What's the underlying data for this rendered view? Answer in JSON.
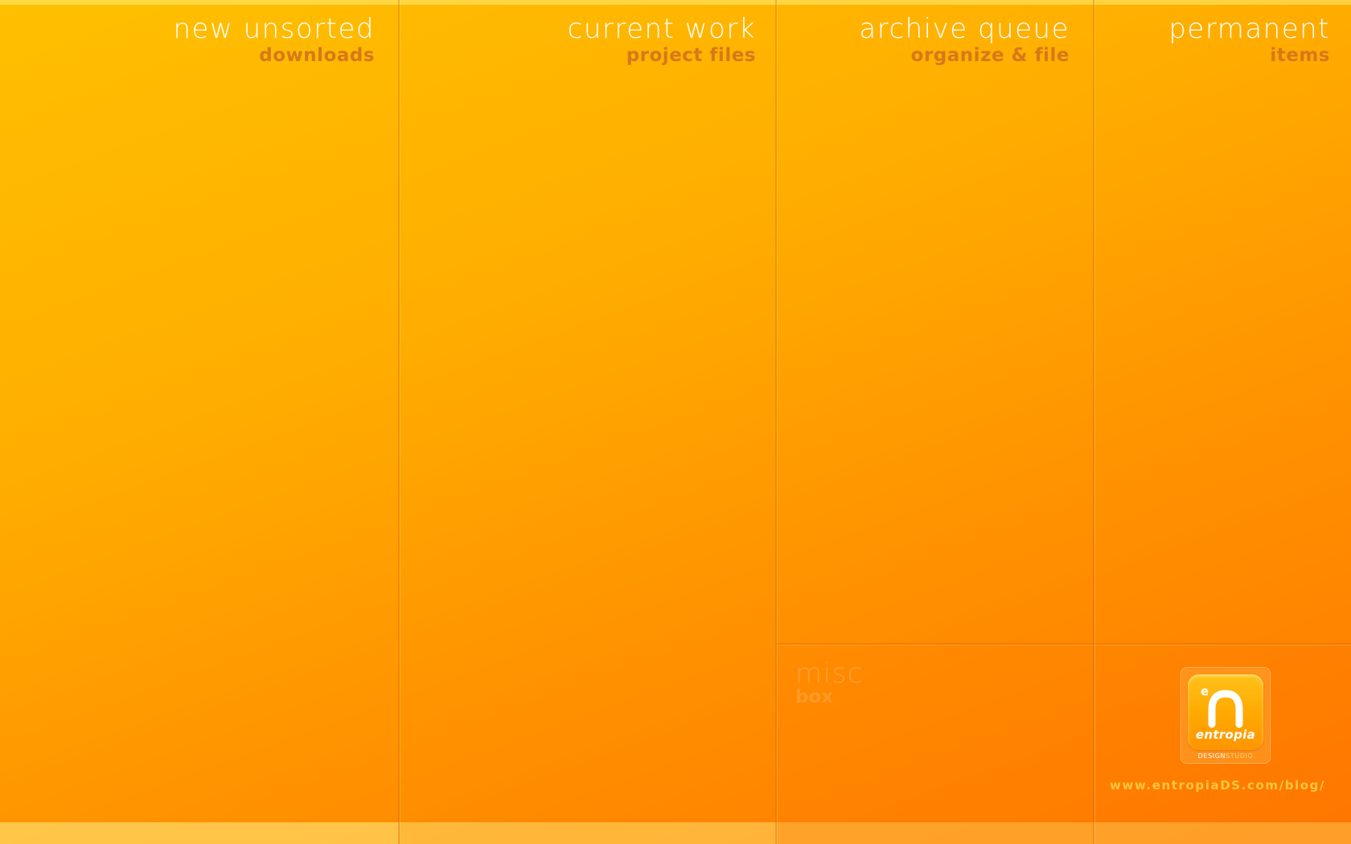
{
  "columns": [
    {
      "id": "downloads",
      "title": "new unsorted",
      "subtitle": "downloads"
    },
    {
      "id": "project-files",
      "title": "current work",
      "subtitle": "project files"
    },
    {
      "id": "archive",
      "title": "archive queue",
      "subtitle": "organize & file"
    },
    {
      "id": "permanent",
      "title": "permanent",
      "subtitle": "items"
    }
  ],
  "misc": {
    "title": "misc",
    "subtitle": "box"
  },
  "logo": {
    "icon": "entropia-n-logo",
    "word": "entropia",
    "tag_primary": "DESIGN",
    "tag_secondary": "STUDIO"
  },
  "footer": {
    "url": "www.entropiaDS.com/blog/"
  },
  "colors": {
    "gradient_top": "#ffc000",
    "gradient_bottom": "#ff7700",
    "title": "#ffffff",
    "subtitle": "#d7781a",
    "misc_text": "#ffa23a",
    "url_text": "#ffc640"
  }
}
